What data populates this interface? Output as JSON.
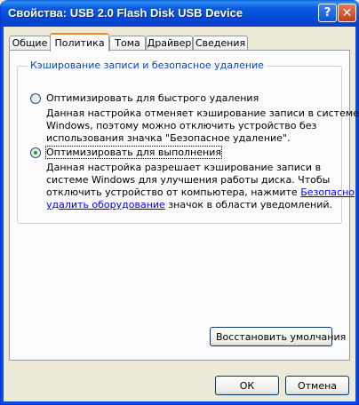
{
  "window": {
    "title": "Свойства: USB 2.0 Flash Disk USB Device",
    "help_glyph": "?",
    "close_glyph": "✕"
  },
  "tabs": [
    {
      "label": "Общие"
    },
    {
      "label": "Политика"
    },
    {
      "label": "Тома"
    },
    {
      "label": "Драйвер"
    },
    {
      "label": "Сведения"
    }
  ],
  "group": {
    "label": "Кэширование записи и безопасное удаление",
    "option1": {
      "label": "Оптимизировать для быстрого удаления",
      "selected": false,
      "desc": [
        "Данная настройка отменяет кэширование записи в системе",
        "Windows, поэтому можно отключить устройство без",
        "использования значка \"Безопасное удаление\"."
      ]
    },
    "option2": {
      "label": "Оптимизировать для выполнения",
      "selected": true,
      "desc": [
        "Данная настройка разрешает кэширование записи в",
        "системе Windows для улучшения работы диска. Чтобы",
        "отключить устройство от компьютера, нажмите "
      ],
      "link_part1": "Безопасно",
      "link_part2": "удалить оборудование",
      "desc_tail": " значок в области уведомлений."
    }
  },
  "buttons": {
    "restore": "Восстановить умолчания",
    "ok": "ОК",
    "cancel": "Отмена"
  }
}
